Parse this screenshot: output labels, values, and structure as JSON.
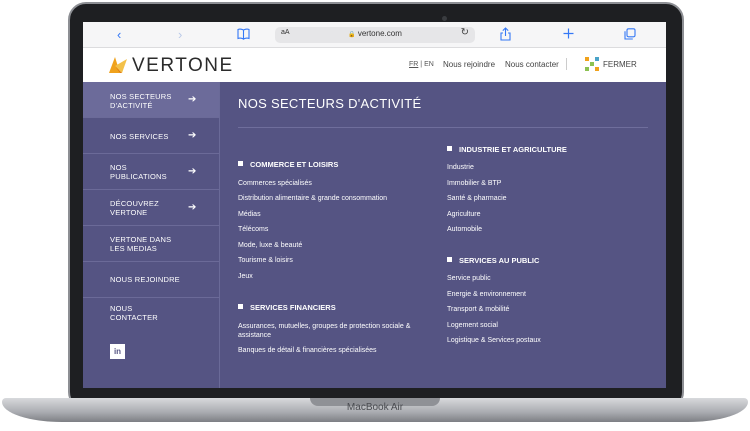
{
  "device": {
    "label": "MacBook Air"
  },
  "browser": {
    "back_icon": "‹",
    "forward_icon": "›",
    "book_icon": "bookmarks-icon",
    "text_size": "aA",
    "url": "vertone.com",
    "lock": "🔒",
    "reload": "↻"
  },
  "header": {
    "logo_text": "VERTONE",
    "lang_fr": "FR",
    "lang_sep": "|",
    "lang_en": "EN",
    "link_join": "Nous rejoindre",
    "link_contact": "Nous contacter",
    "close_label": "FERMER"
  },
  "nav": {
    "items": [
      {
        "label": "NOS SECTEURS D'ACTIVITÉ",
        "arrow": true
      },
      {
        "label": "NOS SERVICES",
        "arrow": true
      },
      {
        "label": "NOS PUBLICATIONS",
        "arrow": true
      },
      {
        "label": "DÉCOUVREZ VERTONE",
        "arrow": true
      },
      {
        "label": "VERTONE DANS LES MEDIAS",
        "arrow": false
      },
      {
        "label": "NOUS REJOINDRE",
        "arrow": false
      },
      {
        "label": "NOUS CONTACTER",
        "arrow": false
      }
    ],
    "arrow_glyph": "➔",
    "linkedin": "in"
  },
  "main": {
    "title": "NOS SECTEURS D'ACTIVITÉ",
    "sections": [
      {
        "heading": "COMMERCE ET LOISIRS",
        "items": [
          "Commerces spécialisés",
          "Distribution alimentaire & grande consommation",
          "Médias",
          "Télécoms",
          "Mode, luxe & beauté",
          "Tourisme & loisirs",
          "Jeux"
        ]
      },
      {
        "heading": "SERVICES FINANCIERS",
        "items": [
          "Assurances, mutuelles, groupes de protection sociale & assistance",
          "Banques de détail & financières spécialisées"
        ]
      },
      {
        "heading": "INDUSTRIE ET AGRICULTURE",
        "items": [
          "Industrie",
          "Immobilier & BTP",
          "Santé & pharmacie",
          "Agriculture",
          "Automobile"
        ]
      },
      {
        "heading": "SERVICES AU PUBLIC",
        "items": [
          "Service public",
          "Energie & environnement",
          "Transport & mobilité",
          "Logement social",
          "Logistique & Services postaux"
        ]
      }
    ]
  },
  "colors": {
    "panel": "#555483",
    "active": "#6c6b9a",
    "accent_orange": "#f0a21c",
    "safari_blue": "#3478f6"
  }
}
